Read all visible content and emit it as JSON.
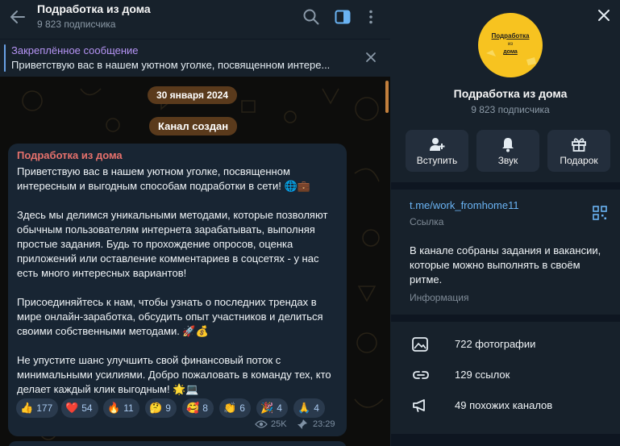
{
  "header": {
    "title": "Подработка из дома",
    "subtitle": "9 823 подписчика"
  },
  "pinned": {
    "title": "Закреплённое сообщение",
    "text": "Приветствую вас в нашем уютном уголке, посвященном интере..."
  },
  "chat": {
    "date_pill": "30 января 2024",
    "service_pill": "Канал создан"
  },
  "message": {
    "author": "Подработка из дома",
    "paragraphs": [
      "Приветствую вас в нашем уютном уголке, посвященном интересным и выгодным способам подработки в сети! 🌐💼",
      "Здесь мы делимся уникальными методами, которые позволяют обычным пользователям интернета зарабатывать, выполняя простые задания. Будь то прохождение опросов, оценка приложений или оставление комментариев в соцсетях - у нас есть много интересных вариантов!",
      "Присоединяйтесь к нам, чтобы узнать о последних трендах в мире онлайн-заработка, обсудить опыт участников и делиться своими собственными методами. 🚀💰",
      "Не упустите шанс улучшить свой финансовый поток с минимальными усилиями. Добро пожаловать в команду тех, кто делает каждый клик выгодным! 🌟💻"
    ],
    "reactions": [
      {
        "emoji": "👍",
        "count": "177"
      },
      {
        "emoji": "❤️",
        "count": "54"
      },
      {
        "emoji": "🔥",
        "count": "11"
      },
      {
        "emoji": "🤔",
        "count": "9"
      },
      {
        "emoji": "🥰",
        "count": "8"
      },
      {
        "emoji": "👏",
        "count": "6"
      },
      {
        "emoji": "🎉",
        "count": "4"
      },
      {
        "emoji": "🙏",
        "count": "4"
      }
    ],
    "views": "25K",
    "time": "23:29"
  },
  "profile": {
    "avatar_text": [
      "Подработка",
      "из",
      "дома"
    ],
    "name": "Подработка из дома",
    "subscribers": "9 823 подписчика",
    "actions": [
      {
        "label": "Вступить",
        "icon": "add-user-icon"
      },
      {
        "label": "Звук",
        "icon": "bell-icon"
      },
      {
        "label": "Подарок",
        "icon": "gift-icon"
      }
    ],
    "link": "t.me/work_fromhome11",
    "link_caption": "Ссылка",
    "description": "В канале собраны задания и вакансии, которые можно выполнять в своём ритме.",
    "description_caption": "Информация",
    "stats": [
      {
        "label": "722 фотографии",
        "icon": "photo-icon"
      },
      {
        "label": "129 ссылок",
        "icon": "link-icon"
      },
      {
        "label": "49 похожих каналов",
        "icon": "megaphone-icon"
      }
    ]
  },
  "colors": {
    "accent": "#6ab3f3",
    "author": "#e6716c",
    "pinned_title": "#b694f5",
    "avatar": "#f7c320",
    "pill": "#5a3a1c"
  }
}
